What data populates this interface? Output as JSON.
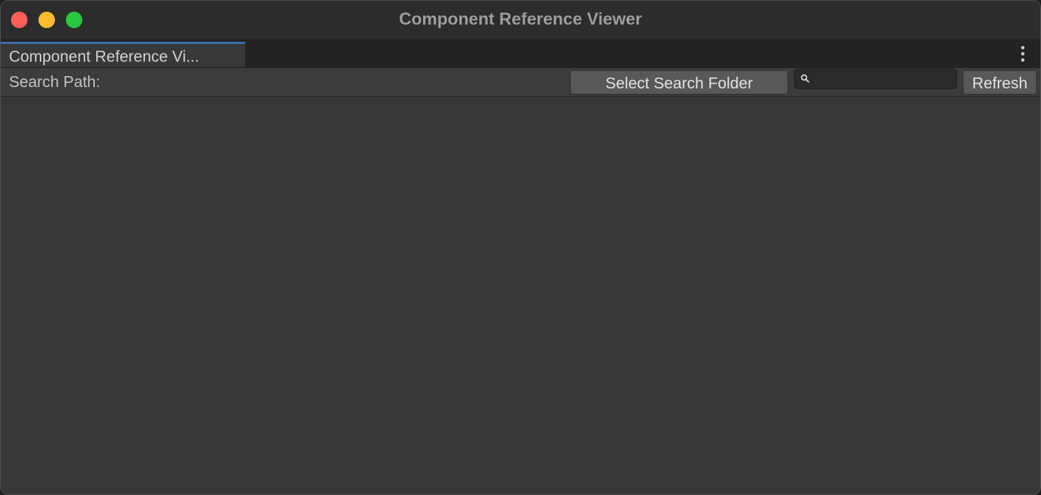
{
  "window": {
    "title": "Component Reference Viewer"
  },
  "tab": {
    "label": "Component Reference Vi..."
  },
  "toolbar": {
    "search_path_label": "Search Path:",
    "select_folder_label": "Select Search Folder",
    "search": {
      "value": "",
      "placeholder": ""
    },
    "refresh_label": "Refresh"
  },
  "icons": {
    "search": "search-icon",
    "more": "more-vertical-icon"
  },
  "colors": {
    "close": "#fe5f57",
    "minimize": "#febc2e",
    "maximize": "#28c840",
    "tab_accent": "#3a72b0"
  }
}
